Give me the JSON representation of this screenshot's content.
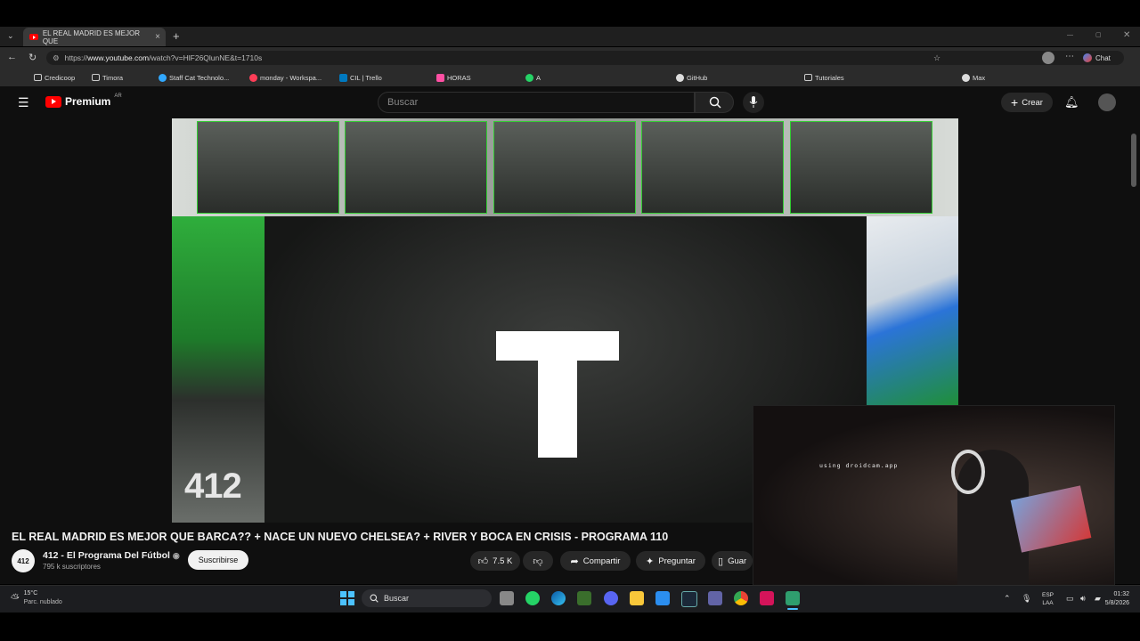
{
  "browser": {
    "tab_title": "EL REAL MADRID ES MEJOR QUE",
    "tab_close": "×",
    "new_tab": "+",
    "url_scheme": "https://",
    "url_host": "www.youtube.com",
    "url_path": "/watch?v=HlF26QlunNE&t=1710s",
    "chat_label": "Chat"
  },
  "bookmarks": [
    {
      "label": "Credicoop",
      "color": "#cccccc"
    },
    {
      "label": "Timora",
      "color": "#cccccc"
    },
    {
      "label": "Staff Cat Technolo...",
      "color": "#31a8ff"
    },
    {
      "label": "monday - Workspa...",
      "color": "#ff3d57"
    },
    {
      "label": "CIL | Trello",
      "color": "#0079bf"
    },
    {
      "label": "HORAS",
      "color": "#ff4fa3"
    },
    {
      "label": "A",
      "color": "#25d366"
    },
    {
      "label": "GitHub",
      "color": "#dddddd"
    },
    {
      "label": "Tutoriales",
      "color": "#cccccc"
    },
    {
      "label": "Max",
      "color": "#dddddd"
    }
  ],
  "youtube": {
    "logo_text": "Premium",
    "logo_region": "AR",
    "search_placeholder": "Buscar",
    "create_label": "Crear",
    "video_title": "EL REAL MADRID ES MEJOR QUE BARCA?? + NACE UN NUEVO CHELSEA? + RIVER Y BOCA EN CRISIS - PROGRAMA 110",
    "channel_avatar_text": "412",
    "channel_name": "412 - El Programa Del Fútbol",
    "subscribers": "795 k suscriptores",
    "subscribe_label": "Suscribirse",
    "like_count": "7.5 K",
    "share_label": "Compartir",
    "ask_label": "Preguntar",
    "save_label": "Guar",
    "video_big_letter": "T",
    "video_brand_text": "412",
    "webcam_overlay_text": "using droidcam.app"
  },
  "taskbar": {
    "weather_temp": "15°C",
    "weather_desc": "Parc. nublado",
    "search_label": "Buscar",
    "lang_top": "ESP",
    "lang_bottom": "LAA",
    "time": "01:32",
    "date": "5/8/2026"
  }
}
